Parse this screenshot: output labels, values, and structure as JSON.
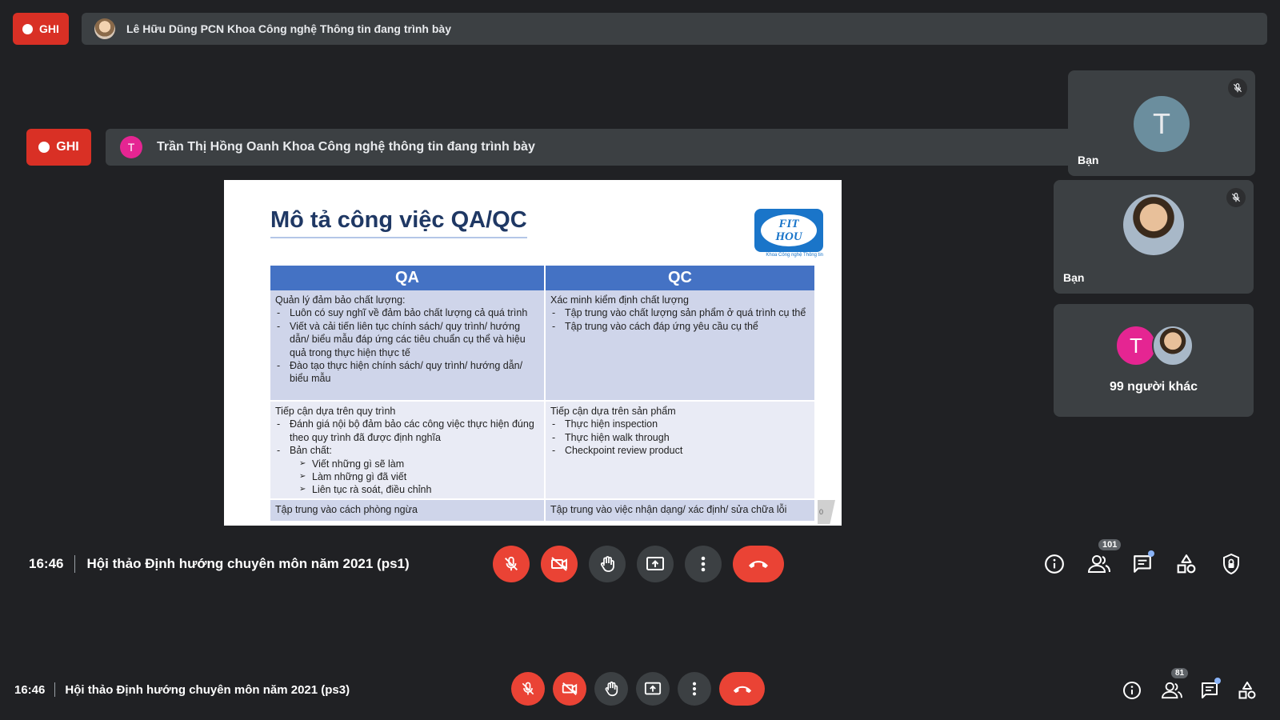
{
  "outer_meeting": {
    "record_label": "GHI",
    "presenter_banner": "Lê Hữu Dũng PCN Khoa Công nghệ Thông tin đang trình bày",
    "time": "16:46",
    "meeting_title": "Hội thảo Định hướng chuyên môn năm 2021 (ps3)",
    "participants_count": "81"
  },
  "inner_meeting": {
    "record_label": "GHI",
    "presenter_initial": "T",
    "presenter_banner": "Trần Thị Hồng Oanh Khoa Công nghệ thông tin đang trình bày",
    "time": "16:46",
    "meeting_title": "Hội thảo Định hướng chuyên môn năm 2021 (ps1)",
    "participants_count": "101"
  },
  "tiles": [
    {
      "initial": "T",
      "name": "Bạn",
      "avatar_color": "#6b8e9e"
    },
    {
      "name": "Bạn"
    },
    {
      "initial": "T",
      "others_label": "99 người khác"
    }
  ],
  "slide": {
    "title": "Mô tả công việc QA/QC",
    "logo_line1": "FIT",
    "logo_line2": "HOU",
    "logo_caption": "Khoa Công nghệ Thông tin",
    "col_qa": "QA",
    "col_qc": "QC",
    "row1_qa_head": "Quản lý đảm bảo chất lượng:",
    "row1_qa_items": [
      "Luôn có suy nghĩ về đảm bảo chất lượng cả quá trình",
      "Viết và cải tiến liên tục chính sách/ quy trình/ hướng dẫn/ biểu mẫu đáp ứng các tiêu chuẩn cụ thể và hiệu quả trong thực hiện thực tế",
      "Đào tạo thực hiện chính sách/ quy trình/ hướng dẫn/ biểu mẫu"
    ],
    "row1_qc_head": "Xác minh kiểm định chất lượng",
    "row1_qc_items": [
      "Tập trung vào chất lượng sản phẩm ở quá trình cụ thể",
      "Tập trung vào cách đáp ứng yêu cầu cụ thể"
    ],
    "row2_qa_head": "Tiếp cận dựa trên quy trình",
    "row2_qa_item1": "Đánh giá nội bộ đảm bảo các công việc thực hiện đúng theo quy trình đã được định nghĩa",
    "row2_qa_item2": "Bản chất:",
    "row2_qa_sub": [
      "Viết những gì sẽ làm",
      "Làm những gì đã viết",
      "Liên tục rà soát, điều chỉnh"
    ],
    "row2_qc_head": "Tiếp cận dựa trên sản phẩm",
    "row2_qc_items": [
      "Thực hiện inspection",
      "Thực hiện walk through",
      "Checkpoint review product"
    ],
    "row3_qa": "Tập trung vào cách phòng ngừa",
    "row3_qc": "Tập trung vào việc nhận dạng/ xác định/ sửa chữa lỗi",
    "page_number": "0"
  },
  "colors": {
    "record_red": "#d93025",
    "hangup_red": "#ea4335",
    "bg": "#202124",
    "banner": "#3c4043",
    "table_header": "#4472c4",
    "title_blue": "#1f3864"
  }
}
